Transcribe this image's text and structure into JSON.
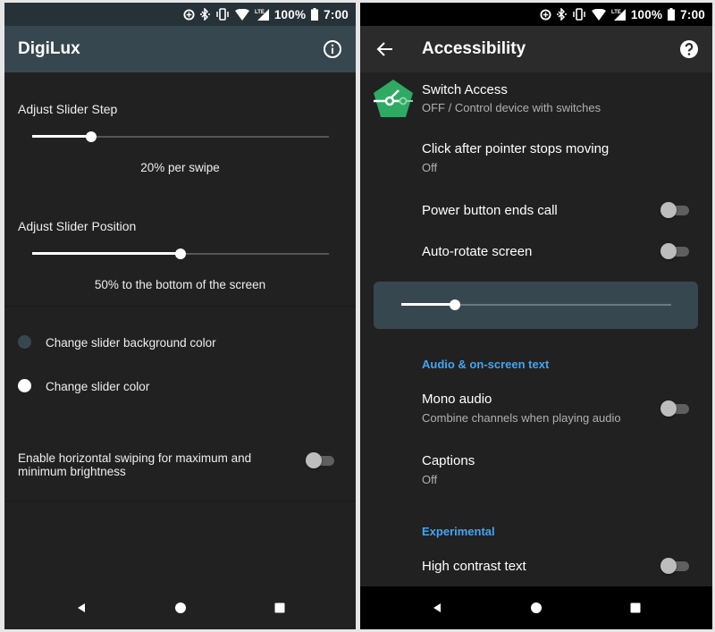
{
  "status_bar": {
    "icons": [
      "data-saver-icon",
      "bluetooth-icon",
      "vibrate-icon",
      "wifi-icon",
      "lte-signal-icon",
      "battery-icon"
    ],
    "battery": "100%",
    "time": "7:00"
  },
  "left_screen": {
    "app_title": "DigiLux",
    "action_icon": "info-icon",
    "slider_step": {
      "label": "Adjust Slider Step",
      "value_percent": 20,
      "caption": "20% per swipe"
    },
    "slider_position": {
      "label": "Adjust Slider Position",
      "value_percent": 50,
      "caption": "50% to the bottom of the screen"
    },
    "color_options": [
      {
        "label": "Change slider background color",
        "color": "#37474f"
      },
      {
        "label": "Change slider color",
        "color": "#ffffff"
      }
    ],
    "horizontal_swipe": {
      "label_line1": "Enable horizontal swiping for maximum and",
      "label_line2": "minimum brightness",
      "enabled": false
    },
    "nav": [
      "back-icon",
      "home-icon",
      "recents-icon"
    ]
  },
  "right_screen": {
    "title": "Accessibility",
    "back_icon": "arrow-back-icon",
    "help_icon": "help-icon",
    "items": [
      {
        "title": "Switch Access",
        "subtitle": "OFF / Control device with switches",
        "icon": "switch-access-icon",
        "icon_color": "#2eaa62"
      },
      {
        "title": "Click after pointer stops moving",
        "subtitle": "Off"
      },
      {
        "title": "Power button ends call",
        "toggle": false
      },
      {
        "title": "Auto-rotate screen",
        "toggle": false
      }
    ],
    "overlay_slider": {
      "value_percent": 20,
      "background": "#37474f"
    },
    "categories": {
      "audio": {
        "label": "Audio & on-screen text",
        "items": [
          {
            "title": "Mono audio",
            "subtitle": "Combine channels when playing audio",
            "toggle": false
          },
          {
            "title": "Captions",
            "subtitle": "Off"
          }
        ]
      },
      "experimental": {
        "label": "Experimental",
        "items": [
          {
            "title": "High contrast text",
            "toggle": false
          }
        ]
      }
    },
    "accent_color": "#42a5f5",
    "nav": [
      "back-icon",
      "home-icon",
      "recents-icon"
    ]
  }
}
